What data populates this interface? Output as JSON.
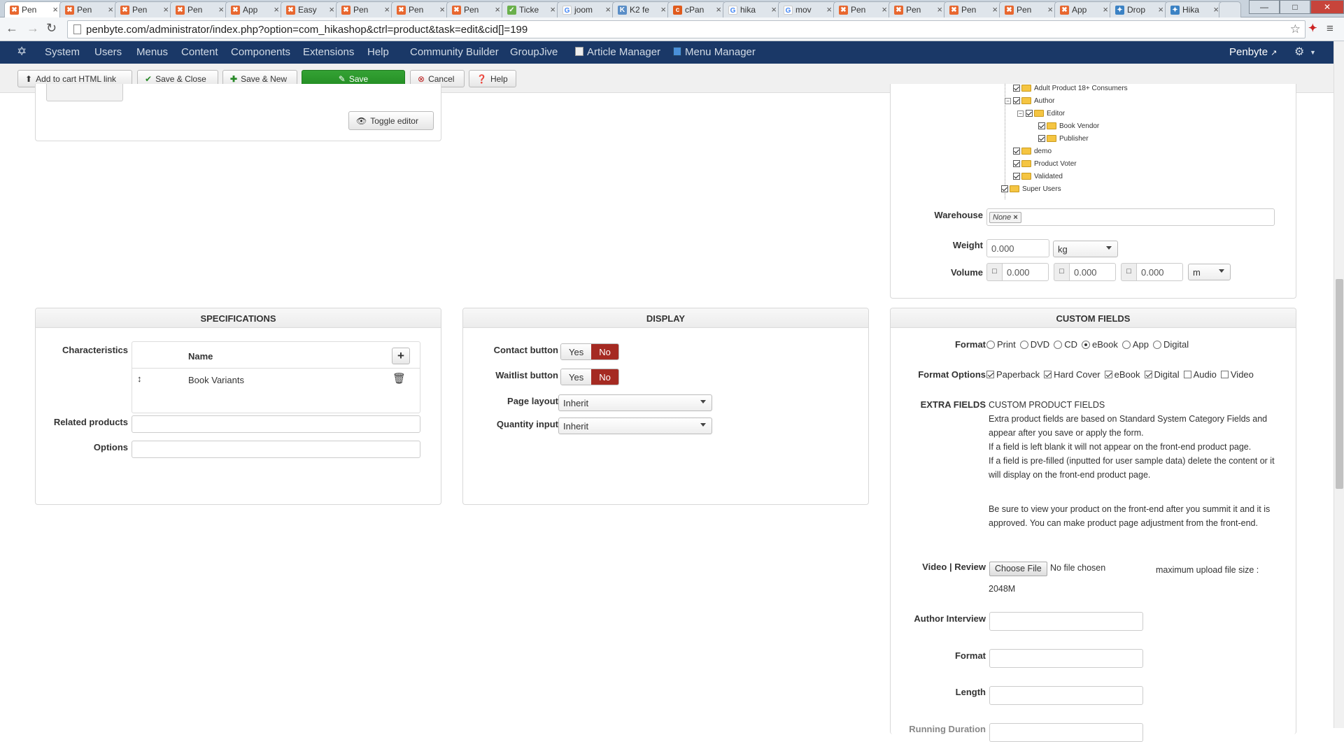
{
  "tabs": [
    {
      "label": "Pen",
      "icon": "j"
    },
    {
      "label": "Pen",
      "icon": "j"
    },
    {
      "label": "Pen",
      "icon": "j"
    },
    {
      "label": "Pen",
      "icon": "j"
    },
    {
      "label": "App",
      "icon": "j"
    },
    {
      "label": "Easy",
      "icon": "j"
    },
    {
      "label": "Pen",
      "icon": "j"
    },
    {
      "label": "Pen",
      "icon": "j"
    },
    {
      "label": "Pen",
      "icon": "j"
    },
    {
      "label": "Ticke",
      "icon": "t"
    },
    {
      "label": "joom",
      "icon": "g"
    },
    {
      "label": "K2 fe",
      "icon": "k"
    },
    {
      "label": "cPan",
      "icon": "c"
    },
    {
      "label": "hika",
      "icon": "g"
    },
    {
      "label": "mov",
      "icon": "g"
    },
    {
      "label": "Pen",
      "icon": "j"
    },
    {
      "label": "Pen",
      "icon": "j"
    },
    {
      "label": "Pen",
      "icon": "j"
    },
    {
      "label": "Pen",
      "icon": "j"
    },
    {
      "label": "App",
      "icon": "j"
    },
    {
      "label": "Drop",
      "icon": "b"
    },
    {
      "label": "Hika",
      "icon": "b"
    }
  ],
  "url": "penbyte.com/administrator/index.php?option=com_hikashop&ctrl=product&task=edit&cid[]=199",
  "topnav": {
    "items": [
      "System",
      "Users",
      "Menus",
      "Content",
      "Components",
      "Extensions",
      "Help",
      "Community Builder",
      "GroupJive",
      "Article Manager",
      "Menu Manager"
    ],
    "user": "Penbyte"
  },
  "toolbar": {
    "add_to_cart": "Add to cart HTML link",
    "save_close": "Save & Close",
    "save_new": "Save & New",
    "save": "Save",
    "cancel": "Cancel",
    "help": "Help"
  },
  "editor": {
    "toggle": "Toggle editor"
  },
  "tree": {
    "items": [
      {
        "label": "Adult Product 18+ Consumers",
        "level": 2
      },
      {
        "label": "Author",
        "level": 2,
        "expander": true
      },
      {
        "label": "Editor",
        "level": 3,
        "expander": true
      },
      {
        "label": "Book Vendor",
        "level": 4
      },
      {
        "label": "Publisher",
        "level": 4
      },
      {
        "label": "demo",
        "level": 2
      },
      {
        "label": "Product Voter",
        "level": 2
      },
      {
        "label": "Validated",
        "level": 2
      },
      {
        "label": "Super Users",
        "level": 1
      }
    ]
  },
  "shipping": {
    "warehouse_label": "Warehouse",
    "warehouse_value": "None",
    "weight_label": "Weight",
    "weight_value": "0.000",
    "weight_unit": "kg",
    "volume_label": "Volume",
    "volume_values": [
      "0.000",
      "0.000",
      "0.000"
    ],
    "volume_unit": "m"
  },
  "specifications": {
    "title": "SPECIFICATIONS",
    "characteristics_label": "Characteristics",
    "name_header": "Name",
    "rows": [
      "Book Variants"
    ],
    "related_label": "Related products",
    "options_label": "Options"
  },
  "display": {
    "title": "DISPLAY",
    "contact_label": "Contact button",
    "waitlist_label": "Waitlist button",
    "yes": "Yes",
    "no": "No",
    "page_layout_label": "Page layout",
    "page_layout_value": "Inherit",
    "quantity_label": "Quantity input",
    "quantity_value": "Inherit"
  },
  "custom_fields": {
    "title": "CUSTOM FIELDS",
    "format_label": "Format",
    "format_options": [
      "Print",
      "DVD",
      "CD",
      "eBook",
      "App",
      "Digital"
    ],
    "format_selected": "eBook",
    "format_options_label": "Format Options",
    "format_checks": [
      {
        "label": "Paperback",
        "checked": true
      },
      {
        "label": "Hard Cover",
        "checked": true
      },
      {
        "label": "eBook",
        "checked": true
      },
      {
        "label": "Digital",
        "checked": true
      },
      {
        "label": "Audio",
        "checked": false
      },
      {
        "label": "Video",
        "checked": false
      }
    ],
    "extra_label": "EXTRA FIELDS",
    "extra_heading": "CUSTOM PRODUCT FIELDS",
    "extra_p1": "Extra product fields are based on Standard System Category Fields and appear after you save or apply the form.",
    "extra_p2": "If a field is left blank it will not appear on the front-end product page.",
    "extra_p3": "If a field is pre-filled (inputted for user sample data) delete the content or it will display on the front-end product page.",
    "extra_p4": "Be sure to view your product on the front-end after you summit it and it is approved. You can make product page adjustment from the front-end.",
    "video_label": "Video | Review",
    "choose_file": "Choose File",
    "no_file": "No file chosen",
    "max_upload": "maximum upload file size :",
    "max_size": "2048M",
    "author_interview_label": "Author Interview",
    "format2_label": "Format",
    "length_label": "Length",
    "last_label": "Running Duration"
  }
}
